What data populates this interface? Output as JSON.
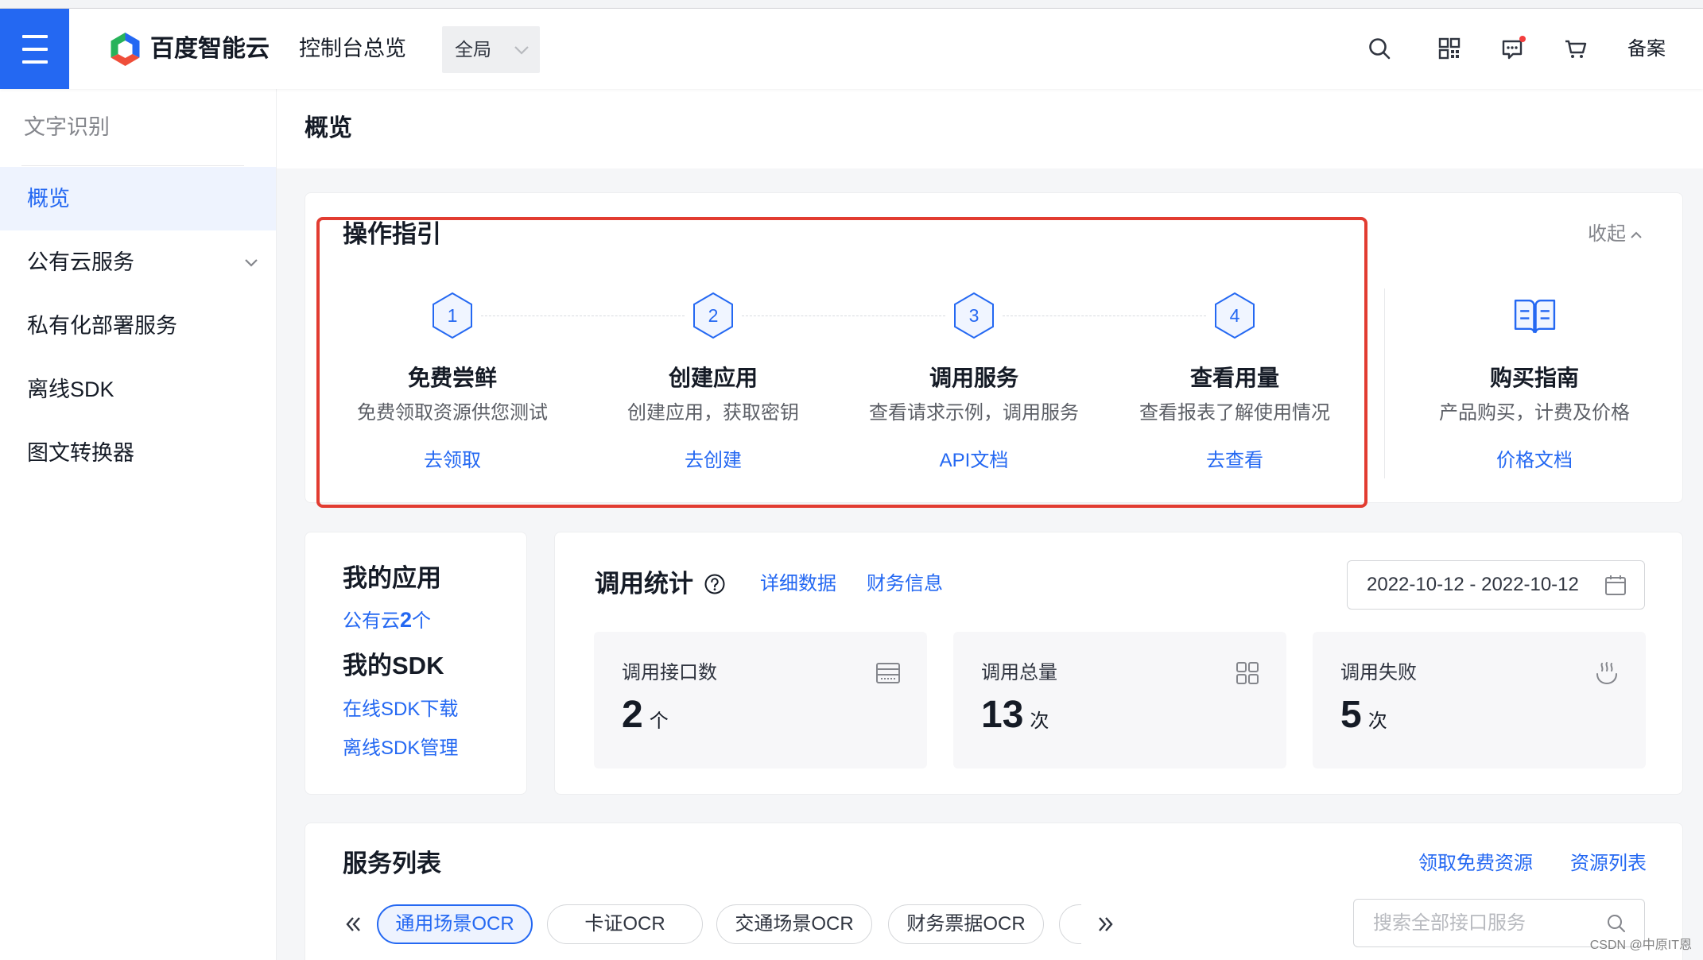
{
  "colors": {
    "brand": "#2468f2",
    "brand_light": "#eef3fe",
    "highlight": "#e23c31",
    "notification_dot": "#f33e3e",
    "page_bg": "#f5f6f8"
  },
  "header": {
    "menu_icon": "hamburger-menu-icon",
    "logo_icon": "baidu-cloud-logo-icon",
    "logo_text": "百度智能云",
    "console_title": "控制台总览",
    "region_select": {
      "value": "全局"
    },
    "icons": [
      "search-icon",
      "qrcode-icon",
      "message-icon",
      "cart-icon"
    ],
    "beian_label": "备案"
  },
  "sidebar": {
    "title": "文字识别",
    "items": [
      {
        "label": "概览",
        "active": true
      },
      {
        "label": "公有云服务",
        "active": false,
        "expandable": true
      },
      {
        "label": "私有化部署服务",
        "active": false
      },
      {
        "label": "离线SDK",
        "active": false
      },
      {
        "label": "图文转换器",
        "active": false
      }
    ]
  },
  "page": {
    "title": "概览"
  },
  "guide": {
    "title": "操作指引",
    "collapse_label": "收起",
    "steps": [
      {
        "number": 1,
        "title": "免费尝鲜",
        "desc": "免费领取资源供您测试",
        "link": "去领取"
      },
      {
        "number": 2,
        "title": "创建应用",
        "desc": "创建应用，获取密钥",
        "link": "去创建"
      },
      {
        "number": 3,
        "title": "调用服务",
        "desc": "查看请求示例，调用服务",
        "link": "API文档"
      },
      {
        "number": 4,
        "title": "查看用量",
        "desc": "查看报表了解使用情况",
        "link": "去查看"
      }
    ],
    "purchase": {
      "icon": "book-icon",
      "title": "购买指南",
      "desc": "产品购买，计费及价格",
      "link": "价格文档"
    }
  },
  "my_apps": {
    "title": "我的应用",
    "public_cloud": {
      "prefix": "公有云",
      "count": 2,
      "suffix": "个"
    },
    "sdk_title": "我的SDK",
    "sdk_links": [
      "在线SDK下载",
      "离线SDK管理"
    ]
  },
  "stats": {
    "title": "调用统计",
    "links": [
      "详细数据",
      "财务信息"
    ],
    "date_range": "2022-10-12 - 2022-10-12",
    "cards": [
      {
        "label": "调用接口数",
        "value": 2,
        "unit": "个",
        "icon": "table-icon"
      },
      {
        "label": "调用总量",
        "value": 13,
        "unit": "次",
        "icon": "grid-icon"
      },
      {
        "label": "调用失败",
        "value": 5,
        "unit": "次",
        "icon": "steam-bowl-icon"
      }
    ]
  },
  "services": {
    "title": "服务列表",
    "links": [
      "领取免费资源",
      "资源列表"
    ],
    "tabs": [
      {
        "label": "通用场景OCR",
        "active": true
      },
      {
        "label": "卡证OCR",
        "active": false
      },
      {
        "label": "交通场景OCR",
        "active": false
      },
      {
        "label": "财务票据OCR",
        "active": false
      }
    ],
    "search_placeholder": "搜索全部接口服务"
  },
  "watermark": "CSDN @中原IT恩"
}
